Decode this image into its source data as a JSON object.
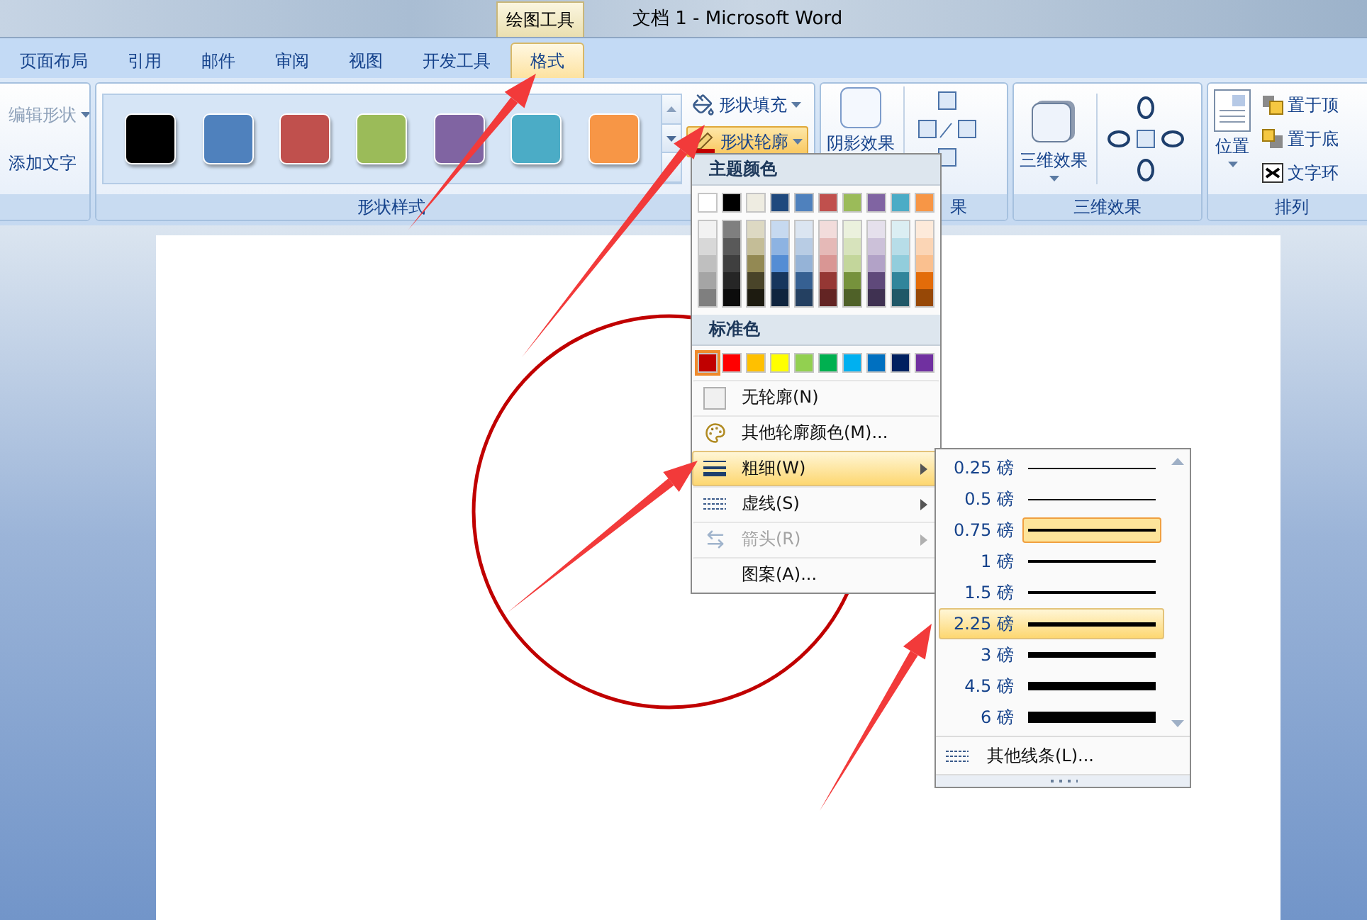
{
  "title_bar": {
    "context_tab": "绘图工具",
    "title": "文档 1 - Microsoft Word"
  },
  "tabs": [
    {
      "label": "页面布局",
      "selected": false
    },
    {
      "label": "引用",
      "selected": false
    },
    {
      "label": "邮件",
      "selected": false
    },
    {
      "label": "审阅",
      "selected": false
    },
    {
      "label": "视图",
      "selected": false
    },
    {
      "label": "开发工具",
      "selected": false
    },
    {
      "label": "格式",
      "selected": true
    }
  ],
  "ribbon": {
    "edit_group": {
      "buttons": [
        {
          "label": "编辑形状",
          "disabled": true
        },
        {
          "label": "添加文字",
          "disabled": false
        }
      ]
    },
    "shape_styles": {
      "label": "形状样式",
      "swatches": [
        {
          "color": "#000000"
        },
        {
          "color": "#4f81bd"
        },
        {
          "color": "#c0504d"
        },
        {
          "color": "#9bbb59"
        },
        {
          "color": "#8064a2"
        },
        {
          "color": "#4bacc6"
        },
        {
          "color": "#f79646"
        }
      ],
      "buttons": [
        {
          "label": "形状填充",
          "kind": "fill",
          "selected": false
        },
        {
          "label": "形状轮廓",
          "kind": "outline",
          "selected": true
        }
      ]
    },
    "shadow_group": {
      "label": "果",
      "button": "阴影效果"
    },
    "three_d_group": {
      "label": "三维效果",
      "button": "三维效果"
    },
    "arrange_group": {
      "label": "排列",
      "position_button": "位置",
      "buttons": [
        {
          "label": "置于顶",
          "kind": "front"
        },
        {
          "label": "置于底",
          "kind": "back"
        },
        {
          "label": "文字环",
          "kind": "wrap"
        }
      ]
    }
  },
  "outline_menu": {
    "theme_header": "主题颜色",
    "theme_colors": [
      {
        "color": "#ffffff"
      },
      {
        "color": "#000000"
      },
      {
        "color": "#eeece1"
      },
      {
        "color": "#1f497d"
      },
      {
        "color": "#4f81bd"
      },
      {
        "color": "#c0504d"
      },
      {
        "color": "#9bbb59"
      },
      {
        "color": "#8064a2"
      },
      {
        "color": "#4bacc6"
      },
      {
        "color": "#f79646"
      }
    ],
    "shade_columns": [
      {
        "shades": [
          {
            "color": "#f2f2f2"
          },
          {
            "color": "#d8d8d8"
          },
          {
            "color": "#bfbfbf"
          },
          {
            "color": "#a5a5a5"
          },
          {
            "color": "#7f7f7f"
          }
        ]
      },
      {
        "shades": [
          {
            "color": "#7f7f7f"
          },
          {
            "color": "#595959"
          },
          {
            "color": "#3f3f3f"
          },
          {
            "color": "#262626"
          },
          {
            "color": "#0c0c0c"
          }
        ]
      },
      {
        "shades": [
          {
            "color": "#ddd9c3"
          },
          {
            "color": "#c4bd97"
          },
          {
            "color": "#938953"
          },
          {
            "color": "#494429"
          },
          {
            "color": "#1d1b10"
          }
        ]
      },
      {
        "shades": [
          {
            "color": "#c6d9f0"
          },
          {
            "color": "#8db3e2"
          },
          {
            "color": "#548dd4"
          },
          {
            "color": "#17365d"
          },
          {
            "color": "#0f243e"
          }
        ]
      },
      {
        "shades": [
          {
            "color": "#dbe5f1"
          },
          {
            "color": "#b8cce4"
          },
          {
            "color": "#95b3d7"
          },
          {
            "color": "#366092"
          },
          {
            "color": "#244061"
          }
        ]
      },
      {
        "shades": [
          {
            "color": "#f2dcdb"
          },
          {
            "color": "#e5b9b7"
          },
          {
            "color": "#d99694"
          },
          {
            "color": "#953734"
          },
          {
            "color": "#632423"
          }
        ]
      },
      {
        "shades": [
          {
            "color": "#ebf1dd"
          },
          {
            "color": "#d7e3bc"
          },
          {
            "color": "#c3d69b"
          },
          {
            "color": "#76923c"
          },
          {
            "color": "#4f6128"
          }
        ]
      },
      {
        "shades": [
          {
            "color": "#e5e0ec"
          },
          {
            "color": "#ccc1d9"
          },
          {
            "color": "#b2a2c7"
          },
          {
            "color": "#5f497a"
          },
          {
            "color": "#3f3151"
          }
        ]
      },
      {
        "shades": [
          {
            "color": "#dbeef3"
          },
          {
            "color": "#b7dde8"
          },
          {
            "color": "#92cddc"
          },
          {
            "color": "#31859b"
          },
          {
            "color": "#205867"
          }
        ]
      },
      {
        "shades": [
          {
            "color": "#fdeada"
          },
          {
            "color": "#fbd5b5"
          },
          {
            "color": "#fac08f"
          },
          {
            "color": "#e36c09"
          },
          {
            "color": "#974806"
          }
        ]
      }
    ],
    "standard_header": "标准色",
    "standard_colors": [
      {
        "color": "#c00000",
        "selected": true
      },
      {
        "color": "#ff0000",
        "selected": false
      },
      {
        "color": "#ffc000",
        "selected": false
      },
      {
        "color": "#ffff00",
        "selected": false
      },
      {
        "color": "#92d050",
        "selected": false
      },
      {
        "color": "#00b050",
        "selected": false
      },
      {
        "color": "#00b0f0",
        "selected": false
      },
      {
        "color": "#0070c0",
        "selected": false
      },
      {
        "color": "#002060",
        "selected": false
      },
      {
        "color": "#7030a0",
        "selected": false
      }
    ],
    "items": [
      {
        "kind": "no-outline",
        "label": "无轮廓(N)",
        "selected": false,
        "disabled": false,
        "submenu": false
      },
      {
        "kind": "more-colors",
        "label": "其他轮廓颜色(M)...",
        "selected": false,
        "disabled": false,
        "submenu": false
      },
      {
        "kind": "weight",
        "label": "粗细(W)",
        "selected": true,
        "disabled": false,
        "submenu": true
      },
      {
        "kind": "dashes",
        "label": "虚线(S)",
        "selected": false,
        "disabled": false,
        "submenu": true
      },
      {
        "kind": "arrows",
        "label": "箭头(R)",
        "selected": false,
        "disabled": true,
        "submenu": true
      },
      {
        "kind": "pattern",
        "label": "图案(A)...",
        "selected": false,
        "disabled": false,
        "submenu": false
      }
    ]
  },
  "weight_menu": {
    "items": [
      {
        "label": "0.25 磅",
        "current": false,
        "selected": false
      },
      {
        "label": "0.5 磅",
        "current": false,
        "selected": false
      },
      {
        "label": "0.75 磅",
        "current": true,
        "selected": false
      },
      {
        "label": "1 磅",
        "current": false,
        "selected": false
      },
      {
        "label": "1.5 磅",
        "current": false,
        "selected": false
      },
      {
        "label": "2.25 磅",
        "current": false,
        "selected": true
      },
      {
        "label": "3 磅",
        "current": false,
        "selected": false
      },
      {
        "label": "4.5 磅",
        "current": false,
        "selected": false
      },
      {
        "label": "6 磅",
        "current": false,
        "selected": false
      }
    ],
    "footer": "其他线条(L)..."
  }
}
